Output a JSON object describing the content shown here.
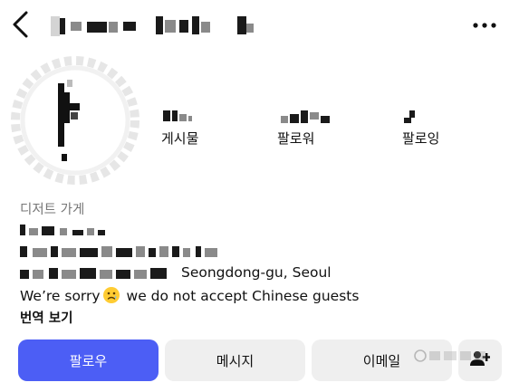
{
  "header": {
    "back_icon": "chevron-left-icon",
    "more_icon": "more-horizontal-icon"
  },
  "profile": {
    "stats": [
      {
        "label": "게시물"
      },
      {
        "label": "팔로워"
      },
      {
        "label": "팔로잉"
      }
    ],
    "category": "디저트 가게",
    "location": "Seongdong-gu, Seoul",
    "notice_before_emoji": "We’re sorry",
    "notice_emoji": "sad-face-emoji",
    "notice_after_emoji": " we do not accept Chinese guests",
    "translate_label": "번역 보기"
  },
  "actions": {
    "follow_label": "팔로우",
    "message_label": "메시지",
    "email_label": "이메일",
    "add_person_icon": "add-person-icon"
  },
  "colors": {
    "follow_button": "#4c5ef5",
    "secondary_button": "#efefef",
    "category_text": "#777777"
  }
}
